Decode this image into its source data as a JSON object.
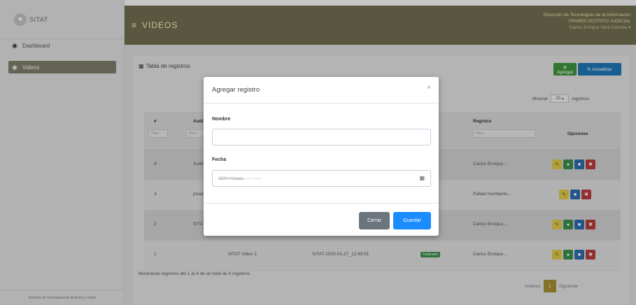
{
  "app": {
    "brand": "SITAT",
    "footer": "Sistema de Transparencia de Audio y Video"
  },
  "sidebar": {
    "items": [
      {
        "label": "Dashboard",
        "icon": "dashboard-icon"
      },
      {
        "label": "Videos",
        "icon": "dashboard-icon",
        "active": true
      }
    ]
  },
  "header": {
    "title": "VIDEOS",
    "org_line1": "Dirección de Tecnologías de la Información",
    "org_line2": "PRIMER DISTRITO JUDICIAL",
    "user": "Carlos Enrique Vera Cazorla"
  },
  "card": {
    "title": "Tabla de registros",
    "add_label": "Agregar",
    "refresh_label": "Actualizar",
    "show_prefix": "Mostrar",
    "show_value": "10",
    "show_suffix": "registros",
    "columns": [
      "#",
      "Audio",
      "Registro",
      "Opciones"
    ],
    "filter_placeholder": "Filtro",
    "rows": [
      {
        "num": "4",
        "audio": "Audio..."
      },
      {
        "num": "3",
        "audio": "prueba..."
      },
      {
        "num": "2",
        "audio": "SITAT..."
      },
      {
        "num": "1",
        "audio": "SITAT Video 1",
        "code": "SITAT-2020-01-27_12:49:51",
        "status": "Publicado"
      }
    ],
    "registros": [
      "Carlos Enrique...",
      "Rafael Humberto...",
      "Carlos Enrique...",
      "Carlos Enrique..."
    ],
    "info": "Mostrando registros del 1 al 4 de un total de 4 registros",
    "pager": {
      "prev": "Anterior",
      "page": "1",
      "next": "Siguiente"
    }
  },
  "modal": {
    "title": "Agregar registro",
    "close_symbol": "×",
    "name_label": "Nombre",
    "name_value": "",
    "date_label": "Fecha",
    "date_placeholder": "dd/mm/aaaa --:-- -----",
    "cancel_label": "Cerrar",
    "save_label": "Guardar"
  },
  "colors": {
    "header": "#6e6b4f",
    "primary": "#1a8cff",
    "success": "#3a8a4a",
    "danger": "#b23b3b",
    "warning": "#d8c24a"
  }
}
